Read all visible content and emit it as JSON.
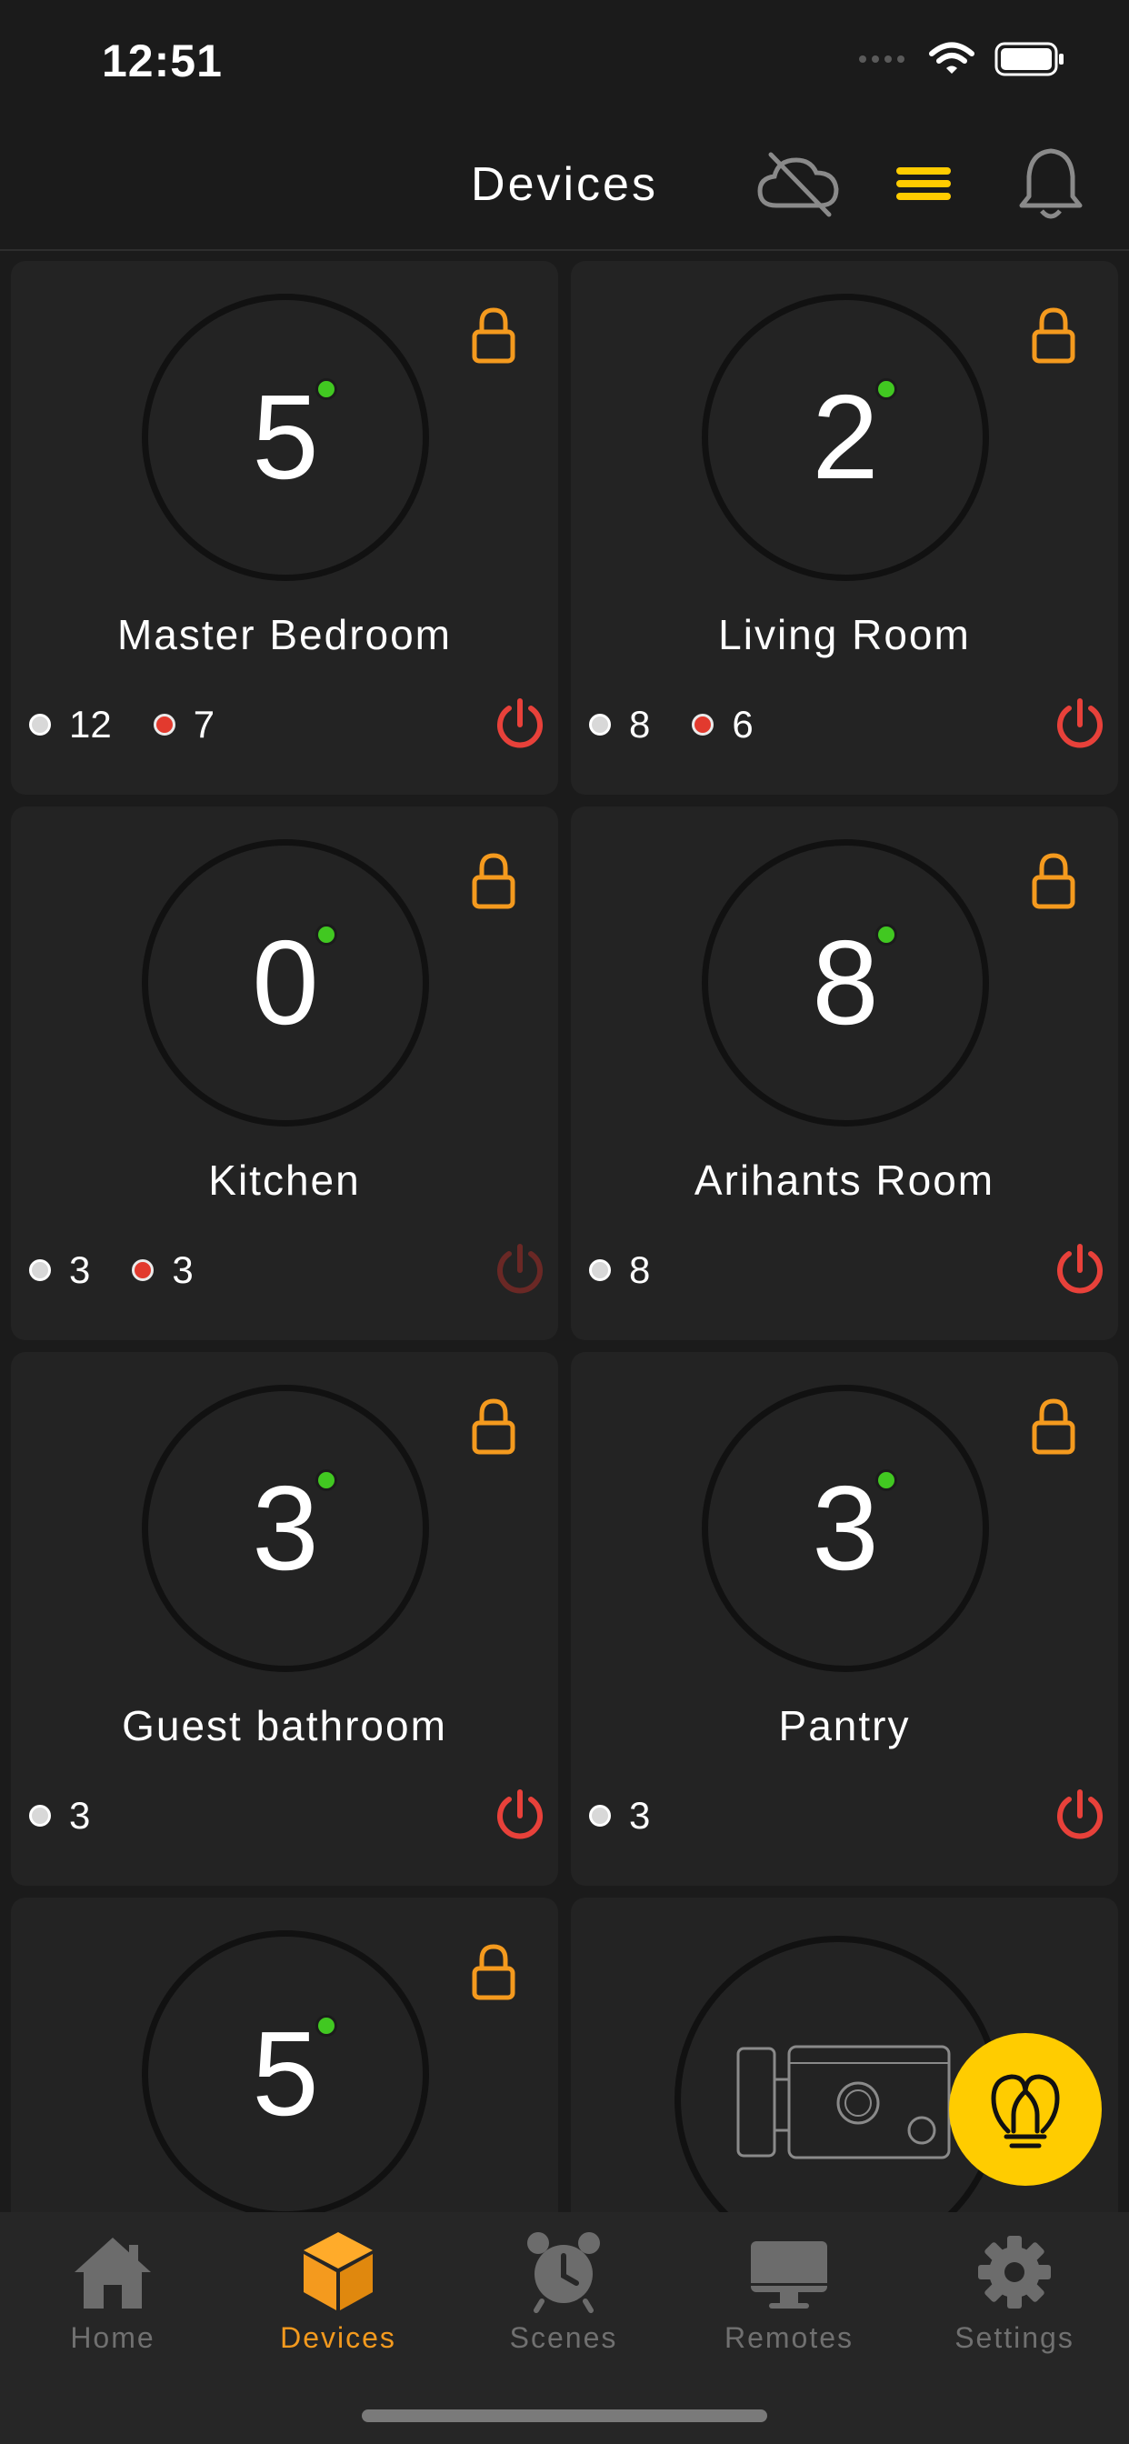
{
  "status": {
    "time": "12:51"
  },
  "header": {
    "title": "Devices"
  },
  "colors": {
    "accent": "#f49a1e",
    "fab": "#ffcc00",
    "online": "#41c821",
    "power_on": "#e8413a",
    "power_dim": "#6a2825"
  },
  "rooms": [
    {
      "count": "5",
      "name": "Master Bedroom",
      "white": "12",
      "red": "7",
      "power": "on"
    },
    {
      "count": "2",
      "name": "Living Room",
      "white": "8",
      "red": "6",
      "power": "on"
    },
    {
      "count": "0",
      "name": "Kitchen",
      "white": "3",
      "red": "3",
      "power": "dim"
    },
    {
      "count": "8",
      "name": "Arihants Room",
      "white": "8",
      "red": null,
      "power": "on"
    },
    {
      "count": "3",
      "name": "Guest bathroom",
      "white": "3",
      "red": null,
      "power": "on"
    },
    {
      "count": "3",
      "name": "Pantry",
      "white": "3",
      "red": null,
      "power": "on"
    },
    {
      "count": "5",
      "name": "",
      "white": null,
      "red": null,
      "power": "on"
    }
  ],
  "tabs": [
    {
      "label": "Home",
      "icon": "home-icon"
    },
    {
      "label": "Devices",
      "icon": "cube-icon"
    },
    {
      "label": "Scenes",
      "icon": "alarm-clock-icon"
    },
    {
      "label": "Remotes",
      "icon": "monitor-icon"
    },
    {
      "label": "Settings",
      "icon": "gear-icon"
    }
  ]
}
